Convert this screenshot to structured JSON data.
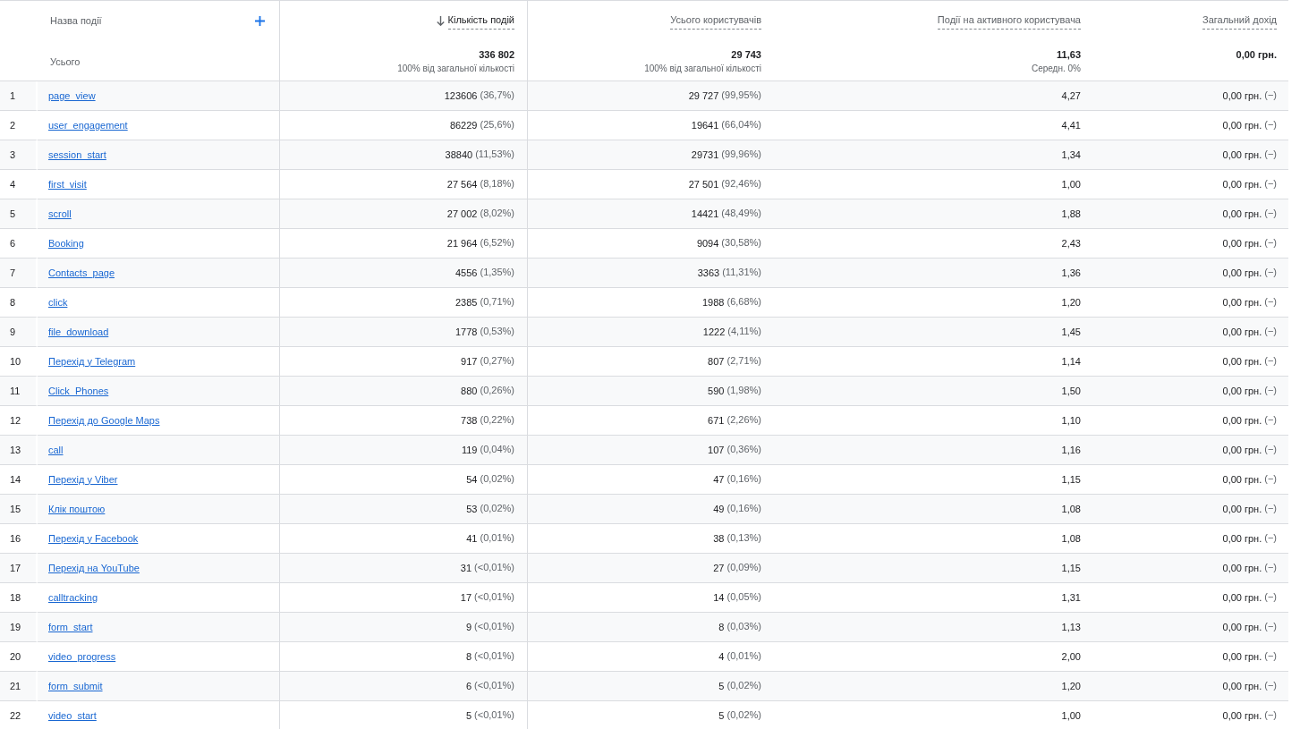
{
  "columns": [
    {
      "label": "Назва події",
      "sorted": false
    },
    {
      "label": "Кількість подій",
      "sorted": true
    },
    {
      "label": "Усього користувачів",
      "sorted": false
    },
    {
      "label": "Події на активного користувача",
      "sorted": false
    },
    {
      "label": "Загальний дохід",
      "sorted": false
    }
  ],
  "totals": {
    "label": "Усього",
    "cells": [
      {
        "value": "336 802",
        "note": "100% від загальної кількості"
      },
      {
        "value": "29 743",
        "note": "100% від загальної кількості"
      },
      {
        "value": "11,63",
        "note": "Середн. 0%"
      },
      {
        "value": "0,00 грн."
      }
    ]
  },
  "rows": [
    {
      "index": "1",
      "name": "page_view",
      "events": "123606",
      "events_pct": "(36,7%)",
      "users": "29 727",
      "users_pct": "(99,95%)",
      "per_user": "4,27",
      "revenue": "0,00 грн.",
      "revenue_pct": "(−)"
    },
    {
      "index": "2",
      "name": "user_engagement",
      "events": "86229",
      "events_pct": "(25,6%)",
      "users": "19641",
      "users_pct": "(66,04%)",
      "per_user": "4,41",
      "revenue": "0,00 грн.",
      "revenue_pct": "(−)"
    },
    {
      "index": "3",
      "name": "session_start",
      "events": "38840",
      "events_pct": "(11,53%)",
      "users": "29731",
      "users_pct": "(99,96%)",
      "per_user": "1,34",
      "revenue": "0,00 грн.",
      "revenue_pct": "(−)"
    },
    {
      "index": "4",
      "name": "first_visit",
      "events": "27 564",
      "events_pct": "(8,18%)",
      "users": "27 501",
      "users_pct": "(92,46%)",
      "per_user": "1,00",
      "revenue": "0,00 грн.",
      "revenue_pct": "(−)"
    },
    {
      "index": "5",
      "name": "scroll",
      "events": "27 002",
      "events_pct": "(8,02%)",
      "users": "14421",
      "users_pct": "(48,49%)",
      "per_user": "1,88",
      "revenue": "0,00 грн.",
      "revenue_pct": "(−)"
    },
    {
      "index": "6",
      "name": "Booking",
      "events": "21 964",
      "events_pct": "(6,52%)",
      "users": "9094",
      "users_pct": "(30,58%)",
      "per_user": "2,43",
      "revenue": "0,00 грн.",
      "revenue_pct": "(−)"
    },
    {
      "index": "7",
      "name": "Contacts_page",
      "events": "4556",
      "events_pct": "(1,35%)",
      "users": "3363",
      "users_pct": "(11,31%)",
      "per_user": "1,36",
      "revenue": "0,00 грн.",
      "revenue_pct": "(−)"
    },
    {
      "index": "8",
      "name": "click",
      "events": "2385",
      "events_pct": "(0,71%)",
      "users": "1988",
      "users_pct": "(6,68%)",
      "per_user": "1,20",
      "revenue": "0,00 грн.",
      "revenue_pct": "(−)"
    },
    {
      "index": "9",
      "name": "file_download",
      "events": "1778",
      "events_pct": "(0,53%)",
      "users": "1222",
      "users_pct": "(4,11%)",
      "per_user": "1,45",
      "revenue": "0,00 грн.",
      "revenue_pct": "(−)"
    },
    {
      "index": "10",
      "name": "Перехід у Telegram",
      "events": "917",
      "events_pct": "(0,27%)",
      "users": "807",
      "users_pct": "(2,71%)",
      "per_user": "1,14",
      "revenue": "0,00 грн.",
      "revenue_pct": "(−)"
    },
    {
      "index": "11",
      "name": "Click_Phones",
      "events": "880",
      "events_pct": "(0,26%)",
      "users": "590",
      "users_pct": "(1,98%)",
      "per_user": "1,50",
      "revenue": "0,00 грн.",
      "revenue_pct": "(−)"
    },
    {
      "index": "12",
      "name": "Перехід до Google Maps",
      "events": "738",
      "events_pct": "(0,22%)",
      "users": "671",
      "users_pct": "(2,26%)",
      "per_user": "1,10",
      "revenue": "0,00 грн.",
      "revenue_pct": "(−)"
    },
    {
      "index": "13",
      "name": "call",
      "events": "119",
      "events_pct": "(0,04%)",
      "users": "107",
      "users_pct": "(0,36%)",
      "per_user": "1,16",
      "revenue": "0,00 грн.",
      "revenue_pct": "(−)"
    },
    {
      "index": "14",
      "name": "Перехід у Viber",
      "events": "54",
      "events_pct": "(0,02%)",
      "users": "47",
      "users_pct": "(0,16%)",
      "per_user": "1,15",
      "revenue": "0,00 грн.",
      "revenue_pct": "(−)"
    },
    {
      "index": "15",
      "name": "Клік поштою",
      "events": "53",
      "events_pct": "(0,02%)",
      "users": "49",
      "users_pct": "(0,16%)",
      "per_user": "1,08",
      "revenue": "0,00 грн.",
      "revenue_pct": "(−)"
    },
    {
      "index": "16",
      "name": "Перехід у Facebook",
      "events": "41",
      "events_pct": "(0,01%)",
      "users": "38",
      "users_pct": "(0,13%)",
      "per_user": "1,08",
      "revenue": "0,00 грн.",
      "revenue_pct": "(−)"
    },
    {
      "index": "17",
      "name": "Перехід на YouTube",
      "events": "31",
      "events_pct": "(<0,01%)",
      "users": "27",
      "users_pct": "(0,09%)",
      "per_user": "1,15",
      "revenue": "0,00 грн.",
      "revenue_pct": "(−)"
    },
    {
      "index": "18",
      "name": "calltracking",
      "events": "17",
      "events_pct": "(<0,01%)",
      "users": "14",
      "users_pct": "(0,05%)",
      "per_user": "1,31",
      "revenue": "0,00 грн.",
      "revenue_pct": "(−)"
    },
    {
      "index": "19",
      "name": "form_start",
      "events": "9",
      "events_pct": "(<0,01%)",
      "users": "8",
      "users_pct": "(0,03%)",
      "per_user": "1,13",
      "revenue": "0,00 грн.",
      "revenue_pct": "(−)"
    },
    {
      "index": "20",
      "name": "video_progress",
      "events": "8",
      "events_pct": "(<0,01%)",
      "users": "4",
      "users_pct": "(0,01%)",
      "per_user": "2,00",
      "revenue": "0,00 грн.",
      "revenue_pct": "(−)"
    },
    {
      "index": "21",
      "name": "form_submit",
      "events": "6",
      "events_pct": "(<0,01%)",
      "users": "5",
      "users_pct": "(0,02%)",
      "per_user": "1,20",
      "revenue": "0,00 грн.",
      "revenue_pct": "(−)"
    },
    {
      "index": "22",
      "name": "video_start",
      "events": "5",
      "events_pct": "(<0,01%)",
      "users": "5",
      "users_pct": "(0,02%)",
      "per_user": "1,00",
      "revenue": "0,00 грн.",
      "revenue_pct": "(−)"
    }
  ]
}
